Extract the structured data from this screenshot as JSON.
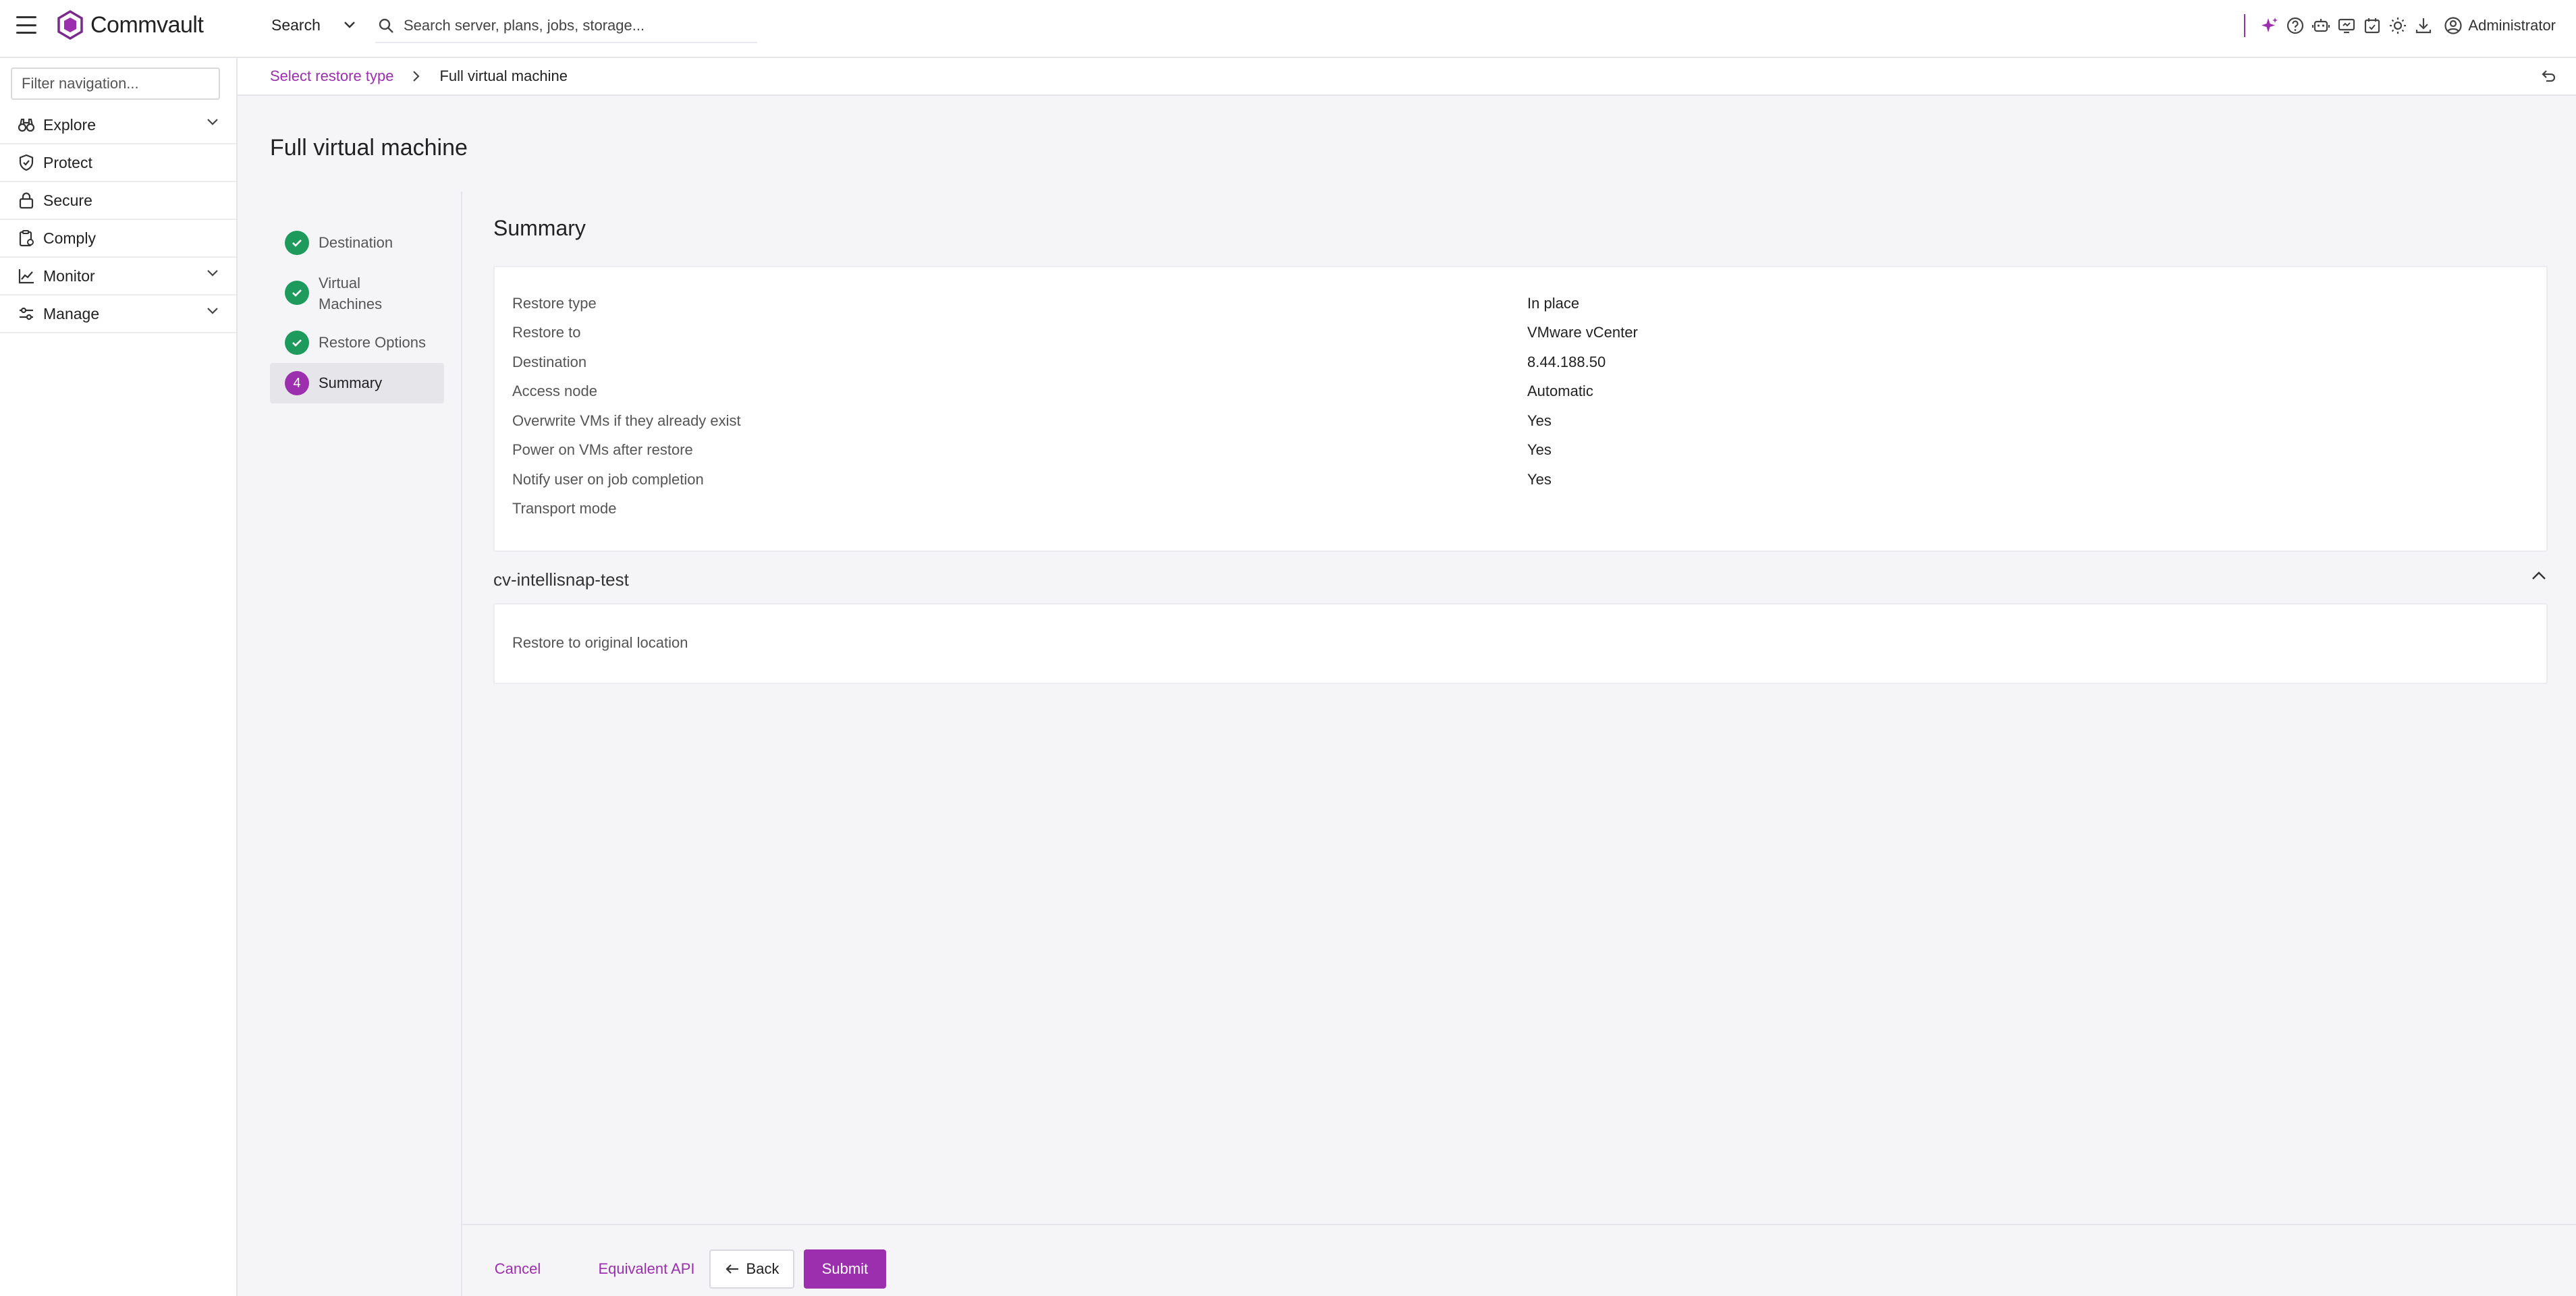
{
  "header": {
    "brand": "Commvault",
    "search_scope": "Search",
    "search_placeholder": "Search server, plans, jobs, storage...",
    "user": "Administrator"
  },
  "sidebar": {
    "filter_placeholder": "Filter navigation...",
    "items": [
      {
        "label": "Explore",
        "icon": "explore-icon",
        "expandable": true
      },
      {
        "label": "Protect",
        "icon": "shield-icon",
        "expandable": false
      },
      {
        "label": "Secure",
        "icon": "lock-icon",
        "expandable": false
      },
      {
        "label": "Comply",
        "icon": "clipboard-icon",
        "expandable": false
      },
      {
        "label": "Monitor",
        "icon": "chart-line-icon",
        "expandable": true
      },
      {
        "label": "Manage",
        "icon": "sliders-icon",
        "expandable": true
      }
    ]
  },
  "breadcrumb": {
    "parent": "Select restore type",
    "current": "Full virtual machine"
  },
  "page": {
    "title": "Full virtual machine"
  },
  "steps": [
    {
      "label": "Destination",
      "status": "done"
    },
    {
      "label": "Virtual Machines",
      "status": "done"
    },
    {
      "label": "Restore Options",
      "status": "done"
    },
    {
      "label": "Summary",
      "status": "active",
      "number": "4"
    }
  ],
  "summary": {
    "title": "Summary",
    "rows": [
      {
        "key": "Restore type",
        "value": "In place"
      },
      {
        "key": "Restore to",
        "value": "VMware vCenter"
      },
      {
        "key": "Destination",
        "value": "8.44.188.50"
      },
      {
        "key": "Access node",
        "value": "Automatic"
      },
      {
        "key": "Overwrite VMs if they already exist",
        "value": "Yes"
      },
      {
        "key": "Power on VMs after restore",
        "value": "Yes"
      },
      {
        "key": "Notify user on job completion",
        "value": "Yes"
      },
      {
        "key": "Transport mode",
        "value": ""
      }
    ]
  },
  "vm_section": {
    "name": "cv-intellisnap-test",
    "detail": "Restore to original location"
  },
  "footer": {
    "cancel": "Cancel",
    "api": "Equivalent API",
    "back": "Back",
    "submit": "Submit"
  },
  "colors": {
    "accent": "#9b2fae",
    "success": "#1e9b5c"
  }
}
